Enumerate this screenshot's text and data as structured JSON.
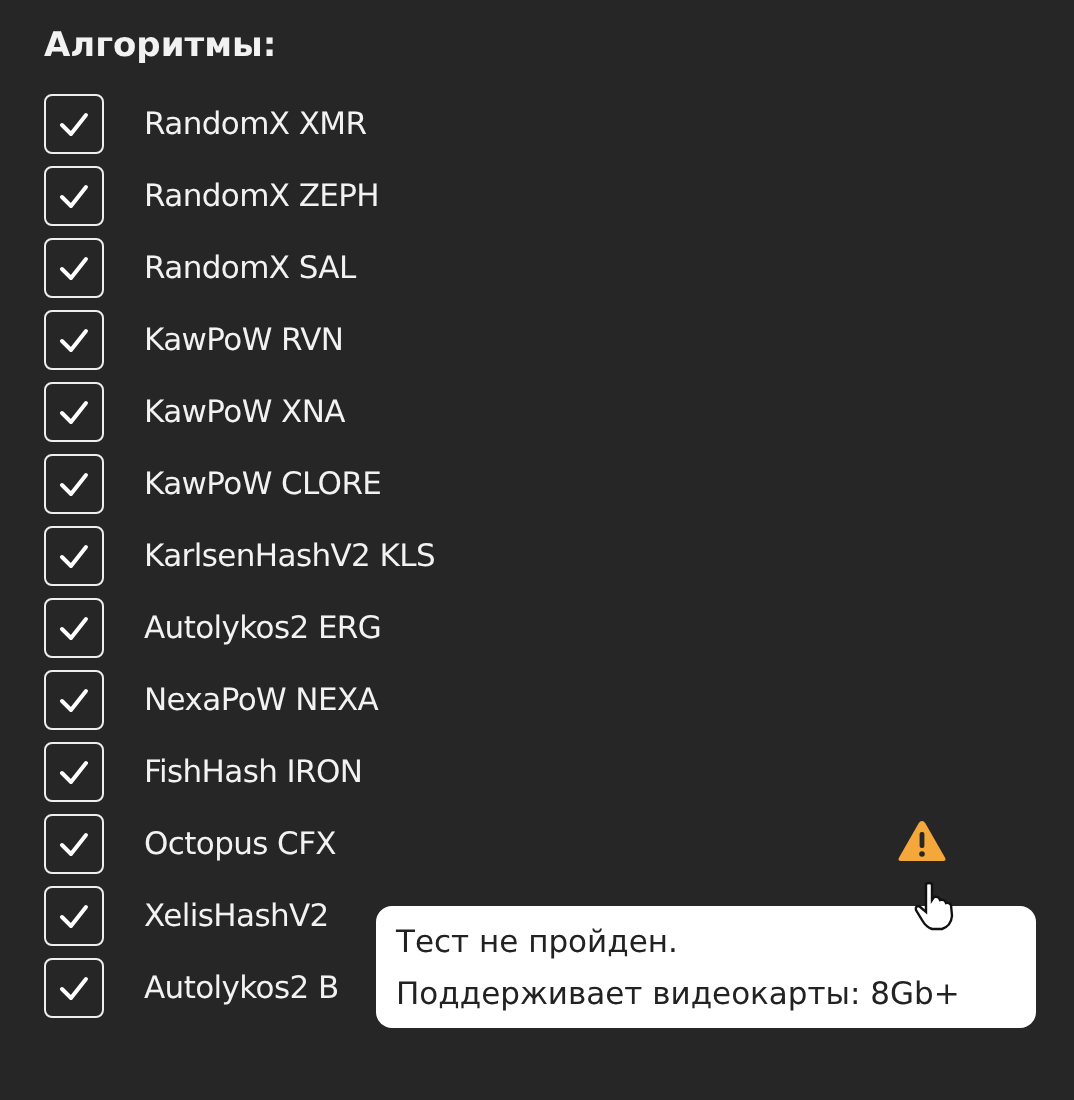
{
  "title": "Алгоритмы:",
  "algorithms": [
    {
      "label": "RandomX XMR",
      "checked": true,
      "warning": false
    },
    {
      "label": "RandomX ZEPH",
      "checked": true,
      "warning": false
    },
    {
      "label": "RandomX SAL",
      "checked": true,
      "warning": false
    },
    {
      "label": "KawPoW RVN",
      "checked": true,
      "warning": false
    },
    {
      "label": "KawPoW XNA",
      "checked": true,
      "warning": false
    },
    {
      "label": "KawPoW CLORE",
      "checked": true,
      "warning": false
    },
    {
      "label": "KarlsenHashV2 KLS",
      "checked": true,
      "warning": false
    },
    {
      "label": "Autolykos2 ERG",
      "checked": true,
      "warning": false
    },
    {
      "label": "NexaPoW NEXA",
      "checked": true,
      "warning": false
    },
    {
      "label": "FishHash IRON",
      "checked": true,
      "warning": false
    },
    {
      "label": "Octopus CFX",
      "checked": true,
      "warning": true
    },
    {
      "label": "XelisHashV2",
      "checked": true,
      "warning": false
    },
    {
      "label": "Autolykos2 B",
      "checked": true,
      "warning": false
    }
  ],
  "tooltip": {
    "lines": [
      "Тест не пройден.",
      "Поддерживает видеокарты: 8Gb+"
    ]
  }
}
